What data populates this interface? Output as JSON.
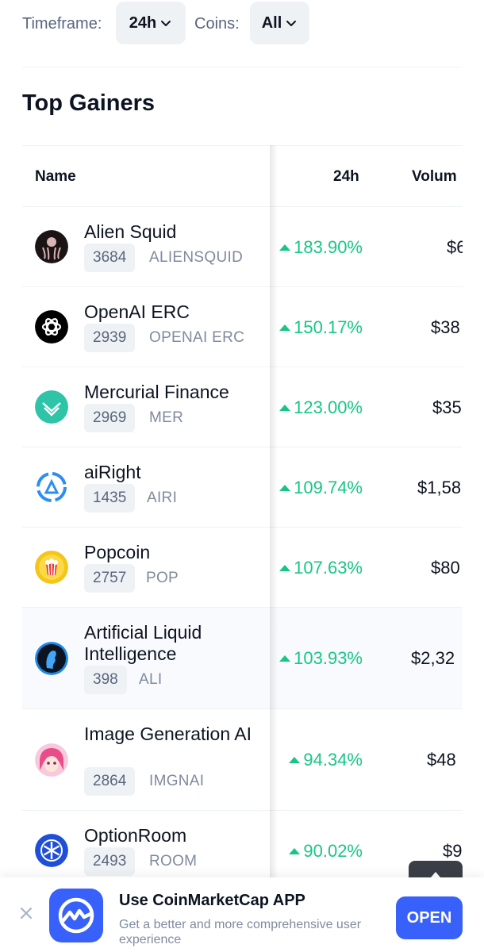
{
  "filters": {
    "timeframe_label": "Timeframe:",
    "timeframe_value": "24h",
    "coins_label": "Coins:",
    "coins_value": "All"
  },
  "section_title": "Top Gainers",
  "table": {
    "headers": {
      "name": "Name",
      "change": "24h",
      "volume": "Volum"
    },
    "rows": [
      {
        "name": "Alien Squid",
        "rank": "3684",
        "symbol": "ALIENSQUID",
        "change": "183.90%",
        "volume": "$6"
      },
      {
        "name": "OpenAI ERC",
        "rank": "2939",
        "symbol": "OPENAI ERC",
        "change": "150.17%",
        "volume": "$38"
      },
      {
        "name": "Mercurial Finance",
        "rank": "2969",
        "symbol": "MER",
        "change": "123.00%",
        "volume": "$35"
      },
      {
        "name": "aiRight",
        "rank": "1435",
        "symbol": "AIRI",
        "change": "109.74%",
        "volume": "$1,58"
      },
      {
        "name": "Popcoin",
        "rank": "2757",
        "symbol": "POP",
        "change": "107.63%",
        "volume": "$80"
      },
      {
        "name": "Artificial Liquid Intelligence",
        "rank": "398",
        "symbol": "ALI",
        "change": "103.93%",
        "volume": "$2,32"
      },
      {
        "name": "Image Generation AI",
        "rank": "2864",
        "symbol": "IMGNAI",
        "change": "94.34%",
        "volume": "$48"
      },
      {
        "name": "OptionRoom",
        "rank": "2493",
        "symbol": "ROOM",
        "change": "90.02%",
        "volume": "$9"
      }
    ]
  },
  "banner": {
    "title": "Use CoinMarketCap APP",
    "description": "Get a better and more comprehensive user experience",
    "open_label": "OPEN"
  },
  "colors": {
    "accent": "#3861fb",
    "gain": "#16c784"
  }
}
